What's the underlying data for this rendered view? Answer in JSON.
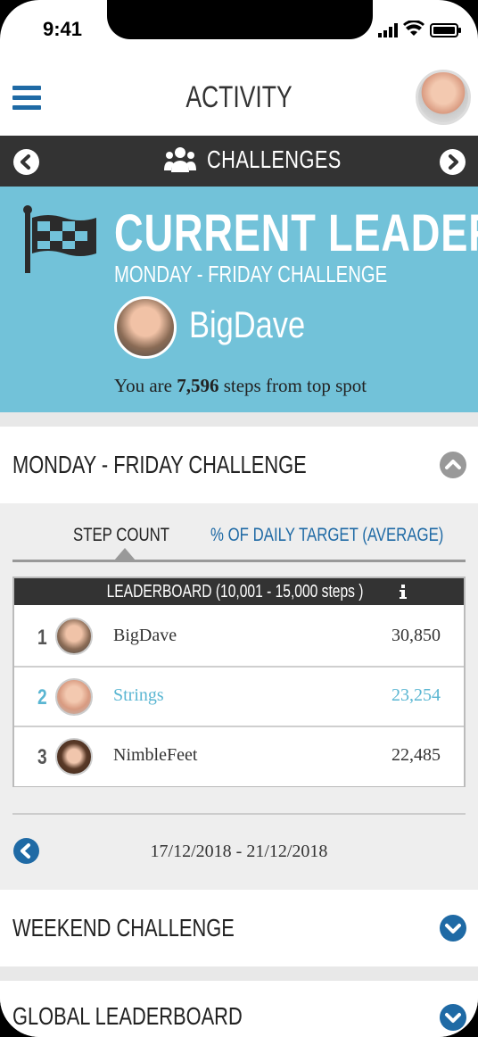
{
  "status": {
    "time": "9:41"
  },
  "app": {
    "title": "ACTIVITY"
  },
  "challenges_nav": {
    "label": "CHALLENGES"
  },
  "current_leader": {
    "title": "CURRENT LEADER",
    "subtitle": "MONDAY - FRIDAY CHALLENGE",
    "name": "BigDave",
    "steps_prefix": "You are ",
    "steps_value": "7,596",
    "steps_suffix": " steps from top spot"
  },
  "monday_friday": {
    "title": "MONDAY - FRIDAY CHALLENGE",
    "tabs": [
      "STEP COUNT",
      "% OF DAILY TARGET (AVERAGE)"
    ],
    "leaderboard_header": "LEADERBOARD (10,001 - 15,000 steps )",
    "rows": [
      {
        "rank": "1",
        "name": "BigDave",
        "score": "30,850",
        "highlight": false
      },
      {
        "rank": "2",
        "name": "Strings",
        "score": "23,254",
        "highlight": true
      },
      {
        "rank": "3",
        "name": "NimbleFeet",
        "score": "22,485",
        "highlight": false
      }
    ],
    "date_range": "17/12/2018 - 21/12/2018"
  },
  "weekend": {
    "title": "WEEKEND CHALLENGE"
  },
  "global": {
    "title": "GLOBAL LEADERBOARD"
  },
  "colors": {
    "accent": "#1f6aa5",
    "leader_bg": "#72c2d9",
    "highlight_text": "#5ab6d2",
    "bar": "#333333"
  }
}
